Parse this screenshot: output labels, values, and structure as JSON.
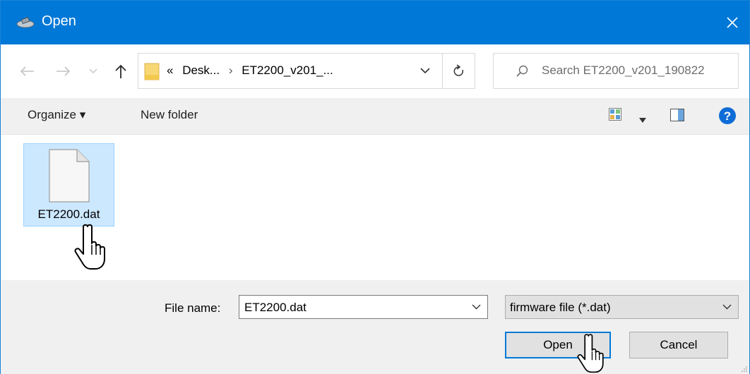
{
  "window": {
    "title": "Open"
  },
  "address": {
    "prefix": "«",
    "crumbs": [
      "Desk...",
      "ET2200_v201_..."
    ],
    "separator": "›"
  },
  "search": {
    "placeholder": "Search ET2200_v201_190822"
  },
  "toolbar": {
    "organize_label": "Organize ▾",
    "new_folder_label": "New folder",
    "help_label": "?"
  },
  "files": [
    {
      "name": "ET2200.dat",
      "selected": true
    }
  ],
  "bottom": {
    "file_name_label": "File name:",
    "file_name_value": "ET2200.dat",
    "file_type_value": "firmware file (*.dat)",
    "open_label": "Open",
    "cancel_label": "Cancel"
  },
  "colors": {
    "titlebar": "#0078d7",
    "selection": "#cce8ff",
    "help": "#0f6cd6"
  }
}
